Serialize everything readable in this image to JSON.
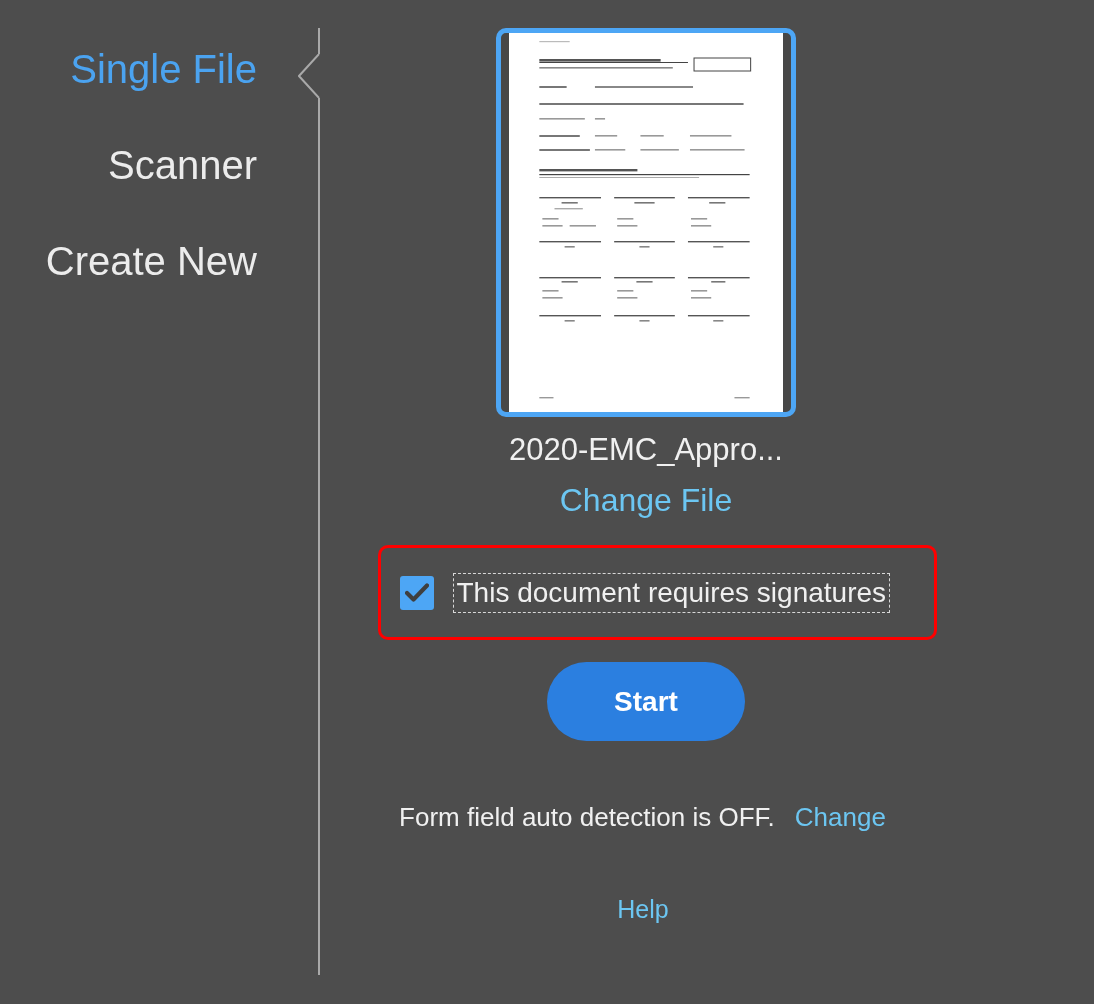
{
  "sidebar": {
    "items": [
      {
        "label": "Single File",
        "selected": true
      },
      {
        "label": "Scanner",
        "selected": false
      },
      {
        "label": "Create New",
        "selected": false
      }
    ]
  },
  "file": {
    "preview": {
      "selected": true
    },
    "name": "2020-EMC_Appro...",
    "change_label": "Change File"
  },
  "signature_option": {
    "label": "This document requires signatures",
    "checked": true,
    "focused": true,
    "highlighted": true
  },
  "start_button": {
    "label": "Start"
  },
  "auto_detection": {
    "status_text": "Form field auto detection is OFF.",
    "change_label": "Change"
  },
  "help_link": {
    "label": "Help"
  }
}
